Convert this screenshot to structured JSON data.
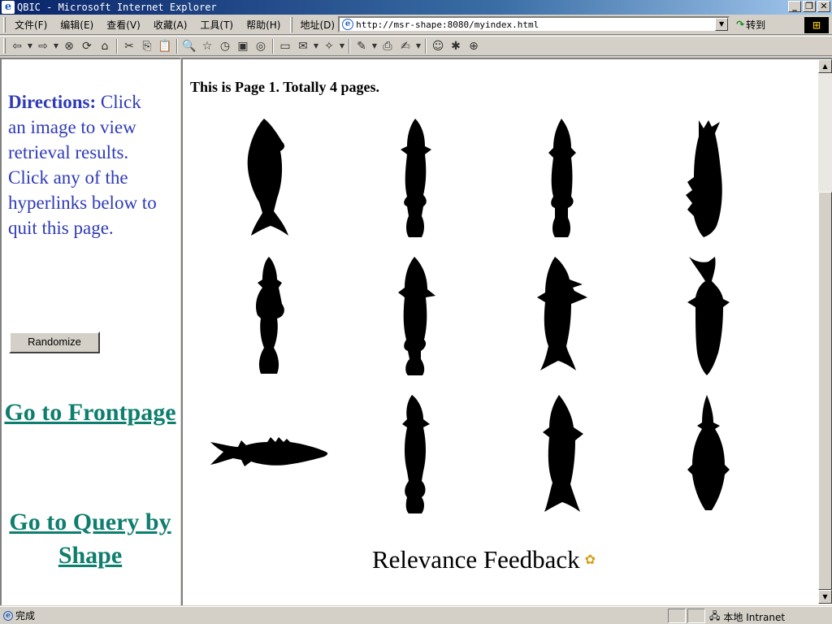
{
  "window": {
    "title": "QBIC - Microsoft Internet Explorer"
  },
  "menu": [
    "文件(F)",
    "编辑(E)",
    "查看(V)",
    "收藏(A)",
    "工具(T)",
    "帮助(H)"
  ],
  "address": {
    "label": "地址(D)",
    "url": "http://msr-shape:8080/myindex.html",
    "go_label": "转到"
  },
  "toolbar_icons": [
    "back-icon",
    "forward-icon",
    "stop-icon",
    "refresh-icon",
    "home-icon",
    "cut-icon",
    "copy-icon",
    "paste-icon",
    "search-icon",
    "favorites-icon",
    "history-icon",
    "media-icon",
    "channels-icon",
    "fullscreen-icon",
    "mail-icon",
    "encoding-icon",
    "edit-icon",
    "print-icon",
    "discuss-icon",
    "messenger-icon",
    "research-icon"
  ],
  "left": {
    "directions_label": "Directions:",
    "directions_text": " Click an image to view retrieval results. Click any of the hyperlinks below to quit this page.",
    "randomize_label": "Randomize",
    "link_frontpage": "Go to Frontpage",
    "link_query": "Go to Query by Shape"
  },
  "right": {
    "page_info": "This is Page 1. Totally 4 pages.",
    "relevance_label": "Relevance Feedback"
  },
  "status": {
    "text": "完成",
    "zone": "本地 Intranet"
  }
}
